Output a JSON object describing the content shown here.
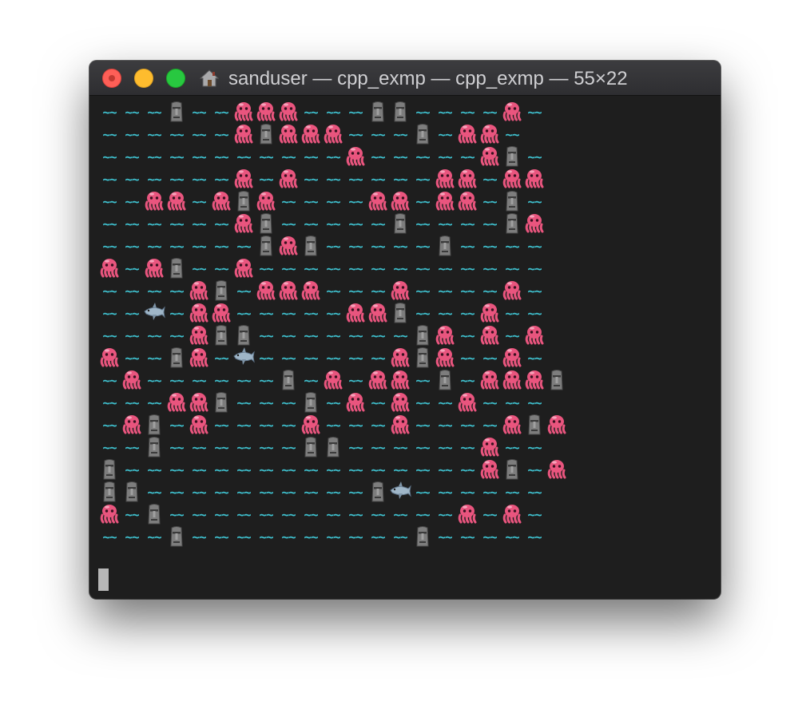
{
  "window": {
    "title": "sanduser — cpp_exmp — cpp_exmp — 55×22",
    "controls": {
      "close": "close",
      "minimize": "minimize",
      "zoom": "zoom"
    },
    "title_icon": "home-icon"
  },
  "colors": {
    "background": "#1e1e1e",
    "titlebar": "#333336",
    "wave": "#3fc1cf",
    "octopus": "#e9557e",
    "moai": "#7d7d7d",
    "shark": "#9fb6c8",
    "cursor": "#b7b7b7"
  },
  "legend": {
    "~": "wave (water)",
    "O": "octopus-icon",
    "M": "moai-icon",
    "S": "shark-icon"
  },
  "terminal": {
    "columns": 20,
    "rows": 20,
    "grid": [
      "~~~M~~OOO~~~MM~~~~O~",
      "~~~~~~OMOOO~~~M~OO~",
      "~~~~~~~~~~~O~~~~~OM~",
      "~~~~~~O~O~~~~~~OO~OO",
      "~~OO~OMO~~~~OO~OO~M~",
      "~~~~~~OM~~~~~M~~~~MO",
      "~~~~~~~MOM~~~~~M~~~~",
      "O~OM~~O~~~~~~~~~~~~~",
      "~~~~OM~OOO~~~O~~~~O~",
      "~~S~OO~~~~~OOM~~~O~~",
      "~~~~OMM~~~~~~~MO~O~O",
      "O~~MO~S~~~~~~OMO~~O~",
      "~O~~~~~~M~O~OO~M~OOOM",
      "~~~OOM~~~M~O~O~~O~~~",
      "~OM~O~~~~O~~~O~~~~OMO",
      "~~M~~~~~~MM~~~~~~O~~",
      "M~~~~~~~~~~~~~~~~OM~O",
      "MM~~~~~~~~~~MS~~~~~~",
      "O~M~~~~~~~~~~~~~O~O~",
      "~~~M~~~~~~~~~~M~~~~~"
    ],
    "cursor": "block-cursor"
  }
}
